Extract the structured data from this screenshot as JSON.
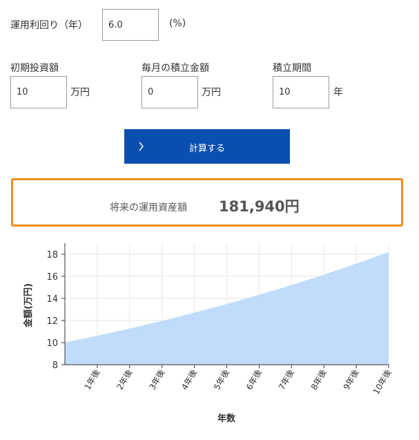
{
  "form": {
    "rate_label": "運用利回り（年）",
    "rate_value": "6.0",
    "rate_unit": "(%)",
    "initial_label": "初期投資額",
    "initial_value": "10",
    "initial_unit": "万円",
    "monthly_label": "毎月の積立金額",
    "monthly_value": "0",
    "monthly_unit": "万円",
    "period_label": "積立期間",
    "period_value": "10",
    "period_unit": "年"
  },
  "button": {
    "label": "計算する",
    "icon": "chevron-right-icon"
  },
  "result": {
    "label": "将来の運用資産額",
    "value": "181,940円"
  },
  "chart_data": {
    "type": "area",
    "ylabel": "金額(万円)",
    "xlabel": "年数",
    "ylim": [
      8,
      19
    ],
    "yticks": [
      8,
      10,
      12,
      14,
      16,
      18
    ],
    "x_tick_labels": [
      "1年後",
      "2年後",
      "3年後",
      "4年後",
      "5年後",
      "6年後",
      "7年後",
      "8年後",
      "9年後",
      "10年後"
    ],
    "x": [
      0,
      1,
      2,
      3,
      4,
      5,
      6,
      7,
      8,
      9,
      10
    ],
    "values": [
      10,
      10.62,
      11.27,
      11.96,
      12.71,
      13.49,
      14.32,
      15.21,
      16.14,
      17.14,
      18.19
    ],
    "grid": true,
    "colors": {
      "fill": "#c0dcfa",
      "grid": "#e6e6e6",
      "axis": "#333333"
    }
  },
  "colors": {
    "accent": "#0a4fb0",
    "highlight": "#f08c1e"
  }
}
